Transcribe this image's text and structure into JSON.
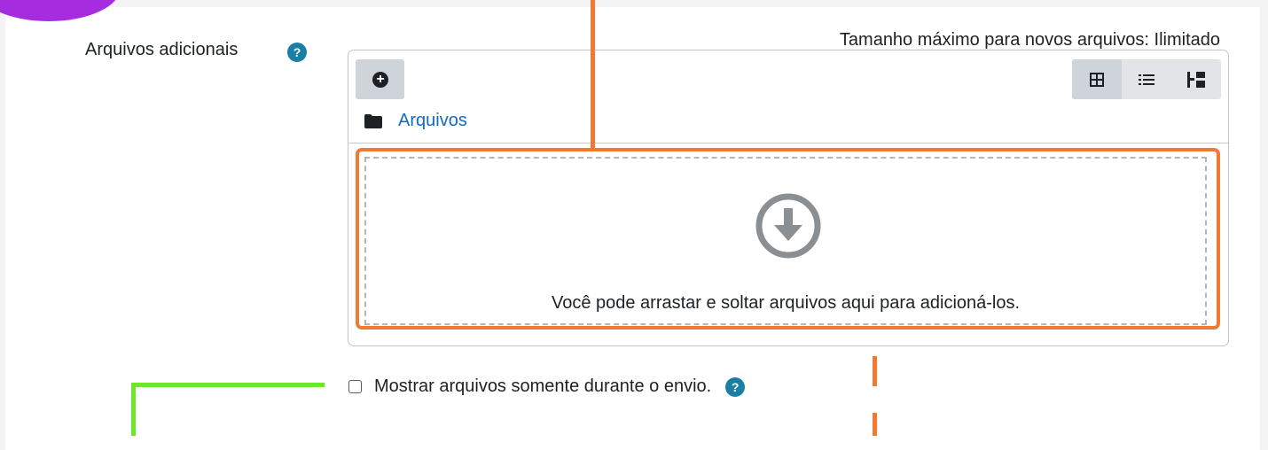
{
  "form": {
    "field_label": "Arquivos adicionais",
    "help_glyph": "?",
    "max_size_text": "Tamanho máximo para novos arquivos: Ilimitado"
  },
  "filemanager": {
    "add_glyph": "+",
    "views": [
      {
        "name": "grid-view-icon",
        "active": true
      },
      {
        "name": "list-view-icon",
        "active": false
      },
      {
        "name": "tree-view-icon",
        "active": false
      }
    ],
    "path_label": "Arquivos",
    "dropzone_text": "Você pode arrastar e soltar arquivos aqui para adicioná-los."
  },
  "checkbox": {
    "label": "Mostrar arquivos somente durante o envio.",
    "checked": false
  },
  "colors": {
    "accent_orange": "#f07a34",
    "accent_green": "#6ee62c",
    "badge_purple": "#a52cdf",
    "link_blue": "#0f6cbf",
    "help_teal": "#1a7fa4"
  }
}
